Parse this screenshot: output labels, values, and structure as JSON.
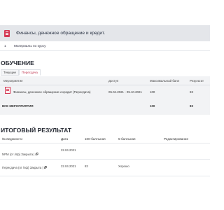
{
  "course": {
    "title": "Финансы, денежное обращение и кредит.",
    "icon": "book-icon",
    "accent_color": "#d43a55"
  },
  "materials": {
    "number": "1",
    "label": "Материалы по курсу"
  },
  "learning": {
    "title": "ОБУЧЕНИЕ",
    "tabs": [
      {
        "label": "Текущие",
        "active": false
      },
      {
        "label": "Пересдача",
        "active": true
      }
    ],
    "columns": [
      "Мероприятие",
      "Доступ",
      "Максимальный балл",
      "Результат"
    ],
    "rows": [
      {
        "event": "Финансы, денежное обращение и кредит (Пересдача)",
        "access": "05.04.2021 - 05.10.2021",
        "max_score": "100",
        "result": "83"
      }
    ],
    "total": {
      "label": "ВСЕ МЕРОПРИЯТИЯ",
      "max_score": "100",
      "result": "83"
    }
  },
  "final": {
    "title": "ИТОГОВЫЙ РЕЗУЛЬТАТ",
    "columns": [
      "№ ведомости",
      "Дата",
      "100-балльная",
      "5-балльная",
      "Редактирование"
    ],
    "rows": [
      {
        "statement": "NPM (от /пф) Закрыта | 🗗",
        "date": "22.04.2021",
        "score100": "",
        "score5": ""
      },
      {
        "statement": "Пересдача (от /пф) Закрыта | 🗗",
        "date": "22.04.2021",
        "score100": "83",
        "score5": "Хорошо"
      }
    ]
  }
}
